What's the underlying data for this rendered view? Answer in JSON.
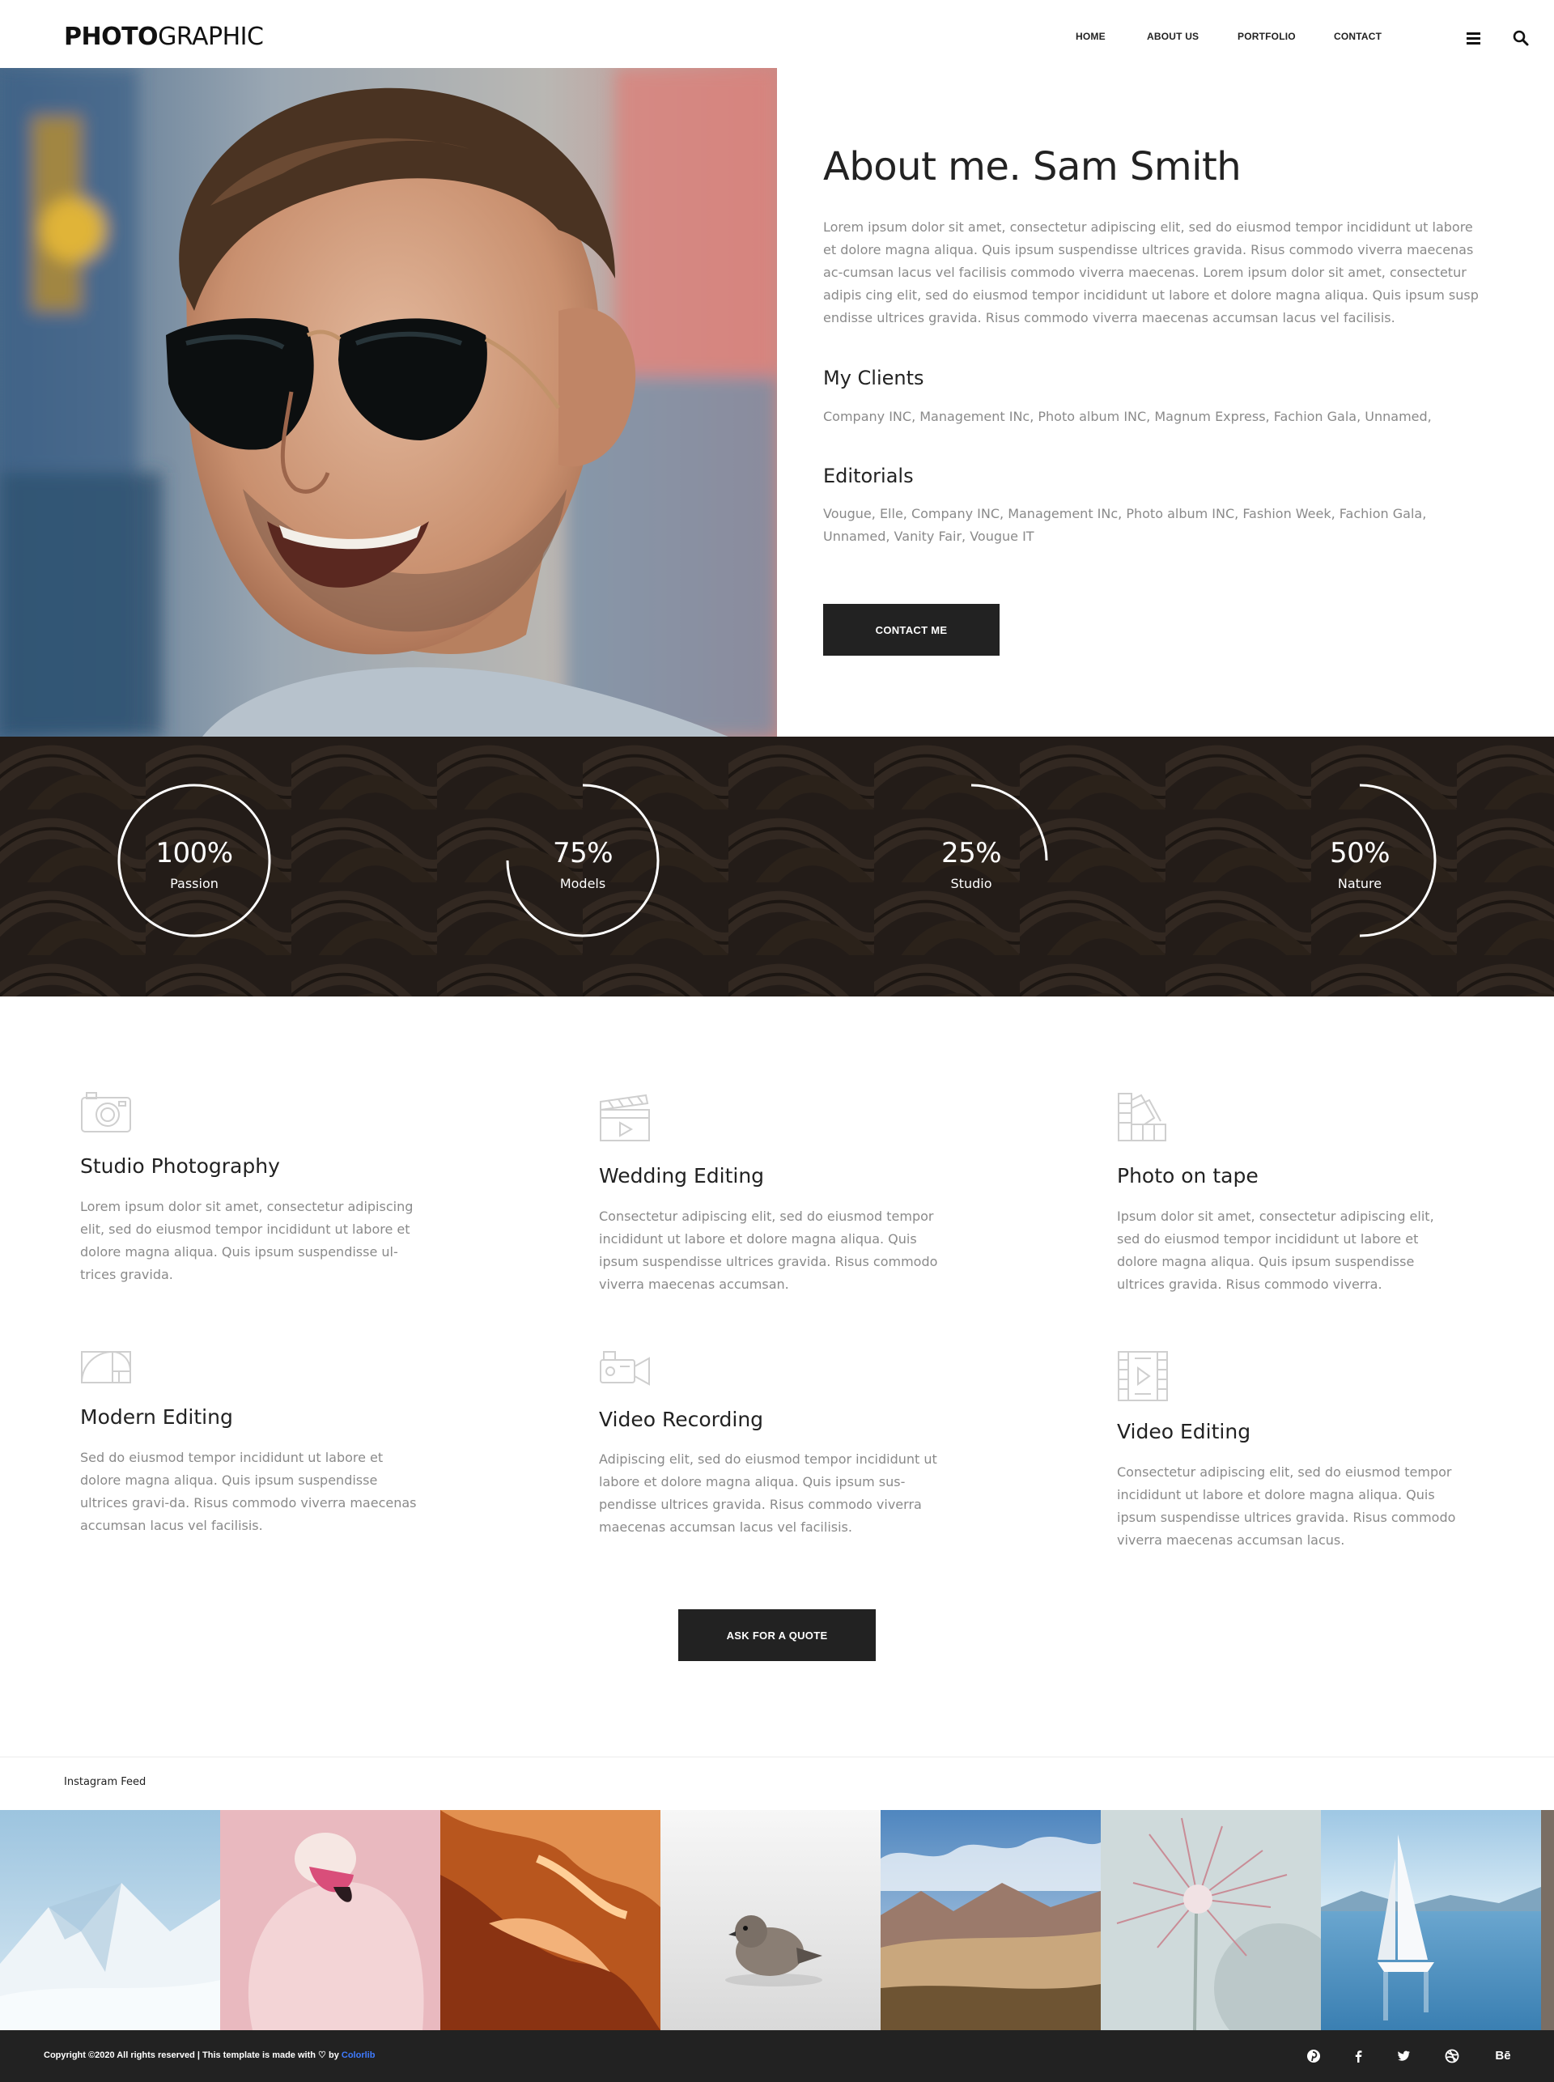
{
  "header": {
    "logo_bold": "PHOTO",
    "logo_light": "GRAPHIC",
    "nav": [
      "HOME",
      "ABOUT US",
      "PORTFOLIO",
      "CONTACT"
    ],
    "icons": [
      "menu-icon",
      "search-icon"
    ]
  },
  "about": {
    "title": "About me. Sam Smith",
    "intro": "Lorem ipsum dolor sit amet, consectetur adipiscing elit, sed do eiusmod tempor incididunt ut labore et dolore magna aliqua. Quis ipsum suspendisse ultrices gravida. Risus commodo viverra maecenas ac-cumsan lacus vel facilisis commodo viverra maecenas. Lorem ipsum dolor sit amet, consectetur adipis cing elit, sed do eiusmod tempor incididunt ut labore et dolore magna aliqua. Quis ipsum susp endisse ultrices gravida. Risus commodo viverra maecenas accumsan lacus vel facilisis.",
    "clients_title": "My Clients",
    "clients_text": "Company INC, Management INc, Photo album INC, Magnum Express, Fachion Gala, Unnamed,",
    "editorials_title": "Editorials",
    "editorials_text": "Vougue, Elle, Company INC, Management INc, Photo album INC, Fashion Week, Fachion Gala, Unnamed, Vanity Fair, Vougue IT",
    "contact_button": "CONTACT ME"
  },
  "stats": [
    {
      "value": "100%",
      "label": "Passion",
      "percent": 100
    },
    {
      "value": "75%",
      "label": "Models",
      "percent": 75
    },
    {
      "value": "25%",
      "label": "Studio",
      "percent": 25
    },
    {
      "value": "50%",
      "label": "Nature",
      "percent": 50
    }
  ],
  "services": [
    {
      "icon": "camera-icon",
      "title": "Studio Photography",
      "text": "Lorem ipsum dolor sit amet, consectetur adipiscing elit, sed do eiusmod tempor incididunt ut labore et dolore magna aliqua. Quis ipsum suspendisse ul-trices gravida."
    },
    {
      "icon": "clapperboard-icon",
      "title": "Wedding Editing",
      "text": "Consectetur adipiscing elit, sed do eiusmod tempor incididunt ut labore et dolore magna aliqua. Quis ipsum suspendisse ultrices gravida. Risus commodo viverra maecenas accumsan."
    },
    {
      "icon": "swatches-icon",
      "title": "Photo on tape",
      "text": "Ipsum dolor sit amet, consectetur adipiscing elit, sed do eiusmod tempor incididunt ut labore et dolore magna aliqua. Quis ipsum suspendisse ultrices gravida. Risus commodo viverra."
    },
    {
      "icon": "golden-ratio-icon",
      "title": "Modern Editing",
      "text": "Sed do eiusmod tempor incididunt ut labore et dolore magna aliqua. Quis ipsum suspendisse ultrices gravi-da. Risus commodo viverra maecenas accumsan lacus vel facilisis."
    },
    {
      "icon": "video-camera-icon",
      "title": "Video Recording",
      "text": "Adipiscing elit, sed do eiusmod tempor incididunt ut labore et dolore magna aliqua. Quis ipsum sus-pendisse ultrices gravida. Risus commodo viverra maecenas accumsan lacus vel facilisis."
    },
    {
      "icon": "film-strip-icon",
      "title": "Video Editing",
      "text": "Consectetur adipiscing elit, sed do eiusmod tempor incididunt ut labore et dolore magna aliqua. Quis ipsum suspendisse ultrices gravida. Risus commodo viverra maecenas accumsan lacus."
    }
  ],
  "quote_button": "ASK FOR A QUOTE",
  "instagram": {
    "label": "Instagram Feed",
    "tiles": [
      "snowy-mountains",
      "flamingo",
      "canyon-sandstone",
      "small-bird",
      "desert-valley",
      "dandelion-flower",
      "sailboat"
    ]
  },
  "footer": {
    "copyright_pre": "Copyright ©2020 All rights reserved | This template is made with ",
    "heart": "♡",
    "copyright_by": " by ",
    "link": "Colorlib",
    "social": [
      "pinterest-icon",
      "facebook-icon",
      "twitter-icon",
      "dribbble-icon",
      "behance-icon"
    ],
    "behance_text": "Bē"
  },
  "colors": {
    "dark": "#222222",
    "text_gray": "#8a8a8a",
    "link_blue": "#3f7bff"
  }
}
